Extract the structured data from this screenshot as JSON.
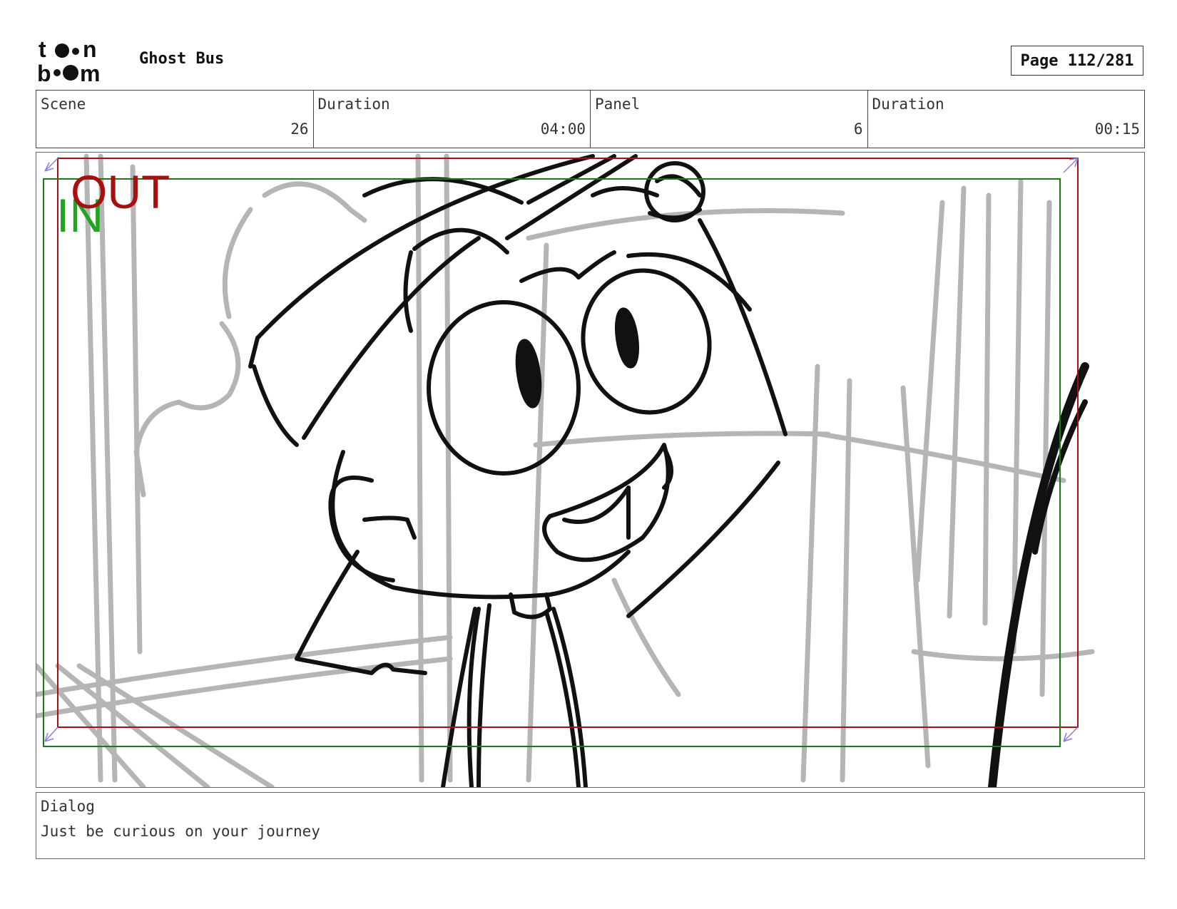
{
  "header": {
    "logo_text": "toonboom",
    "project_title": "Ghost Bus",
    "page_label": "Page",
    "page_number": "112/281"
  },
  "info": {
    "scene_label": "Scene",
    "scene_value": "26",
    "scene_duration_label": "Duration",
    "scene_duration_value": "04:00",
    "panel_label": "Panel",
    "panel_value": "6",
    "panel_duration_label": "Duration",
    "panel_duration_value": "00:15"
  },
  "panel": {
    "in_label": "IN",
    "out_label": "OUT",
    "in_frame_color": "#1a7a1a",
    "out_frame_color": "#a81010"
  },
  "dialog": {
    "label": "Dialog",
    "text": "Just be curious on your journey"
  }
}
